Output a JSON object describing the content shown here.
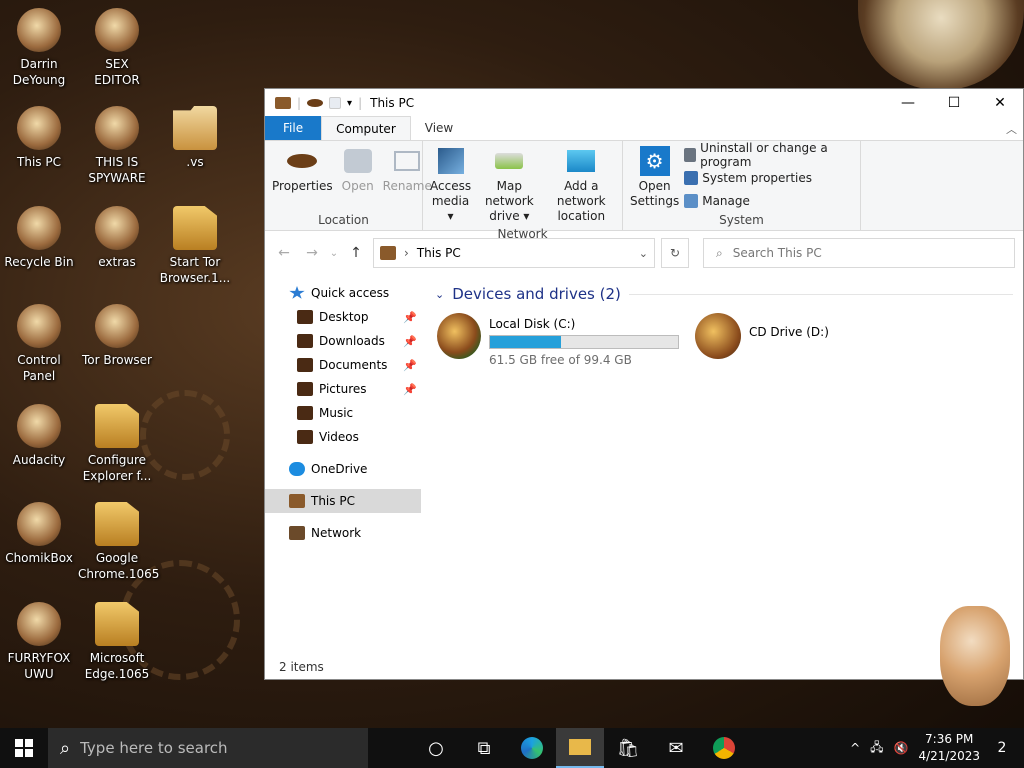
{
  "desktop_icons": [
    {
      "label": "Darrin\nDeYoung",
      "icon": "steampunk-figure-icon"
    },
    {
      "label": "SEX\nEDITOR",
      "icon": "hex-editor-icon"
    },
    {
      "label": "This PC",
      "icon": "computer-icon"
    },
    {
      "label": "THIS IS\nSPYWARE",
      "icon": "chrome-icon"
    },
    {
      "label": ".vs",
      "icon": "folder-icon"
    },
    {
      "label": "Recycle Bin",
      "icon": "recycle-bin-icon"
    },
    {
      "label": "extras",
      "icon": "document-icon"
    },
    {
      "label": "Start Tor\nBrowser.1...",
      "icon": "file-icon"
    },
    {
      "label": "Control Panel",
      "icon": "lightbulb-icon"
    },
    {
      "label": "Tor Browser",
      "icon": "tor-icon"
    },
    {
      "label": "Audacity",
      "icon": "audacity-icon"
    },
    {
      "label": "Configure\nExplorer f...",
      "icon": "file-icon"
    },
    {
      "label": "ChomikBox",
      "icon": "hamster-icon"
    },
    {
      "label": "Google\nChrome.1065",
      "icon": "file-icon"
    },
    {
      "label": "FURRYFOX\nUWU",
      "icon": "firefox-icon"
    },
    {
      "label": "Microsoft\nEdge.1065",
      "icon": "file-icon"
    }
  ],
  "window": {
    "title": "This PC",
    "controls": {
      "minimize": "—",
      "maximize": "☐",
      "close": "✕"
    },
    "tabs": [
      {
        "label": "File"
      },
      {
        "label": "Computer"
      },
      {
        "label": "View"
      }
    ],
    "ribbon": {
      "location": {
        "label": "Location",
        "buttons": [
          {
            "label": "Properties",
            "disabled": false
          },
          {
            "label": "Open",
            "disabled": true
          },
          {
            "label": "Rename",
            "disabled": true
          }
        ]
      },
      "network": {
        "label": "Network",
        "buttons": [
          {
            "label": "Access\nmedia ▾"
          },
          {
            "label": "Map network\ndrive ▾"
          },
          {
            "label": "Add a network\nlocation"
          }
        ]
      },
      "system": {
        "label": "System",
        "open_settings": "Open\nSettings",
        "small": [
          {
            "label": "Uninstall or change a program"
          },
          {
            "label": "System properties"
          },
          {
            "label": "Manage"
          }
        ]
      }
    },
    "address": {
      "crumb": "This PC",
      "search_placeholder": "Search This PC"
    },
    "nav": [
      {
        "label": "Quick access",
        "level": 1,
        "pinned": false
      },
      {
        "label": "Desktop",
        "level": 2,
        "pinned": true
      },
      {
        "label": "Downloads",
        "level": 2,
        "pinned": true
      },
      {
        "label": "Documents",
        "level": 2,
        "pinned": true
      },
      {
        "label": "Pictures",
        "level": 2,
        "pinned": true
      },
      {
        "label": "Music",
        "level": 2,
        "pinned": false
      },
      {
        "label": "Videos",
        "level": 2,
        "pinned": false
      },
      {
        "label": "OneDrive",
        "level": 1,
        "pinned": false
      },
      {
        "label": "This PC",
        "level": 1,
        "pinned": false,
        "selected": true
      },
      {
        "label": "Network",
        "level": 1,
        "pinned": false
      }
    ],
    "section_title": "Devices and drives (2)",
    "drives": [
      {
        "name": "Local Disk (C:)",
        "free_text": "61.5 GB free of 99.4 GB",
        "used_fraction": 0.38
      },
      {
        "name": "CD Drive (D:)"
      }
    ],
    "status": "2 items"
  },
  "taskbar": {
    "search_placeholder": "Type here to search",
    "time": "7:36 PM",
    "date": "4/21/2023",
    "notification_count": "2"
  },
  "colors": {
    "accent": "#1979ca",
    "drive_bar": "#26a0da",
    "section_header": "#1e3287",
    "taskbar": "#101010"
  }
}
